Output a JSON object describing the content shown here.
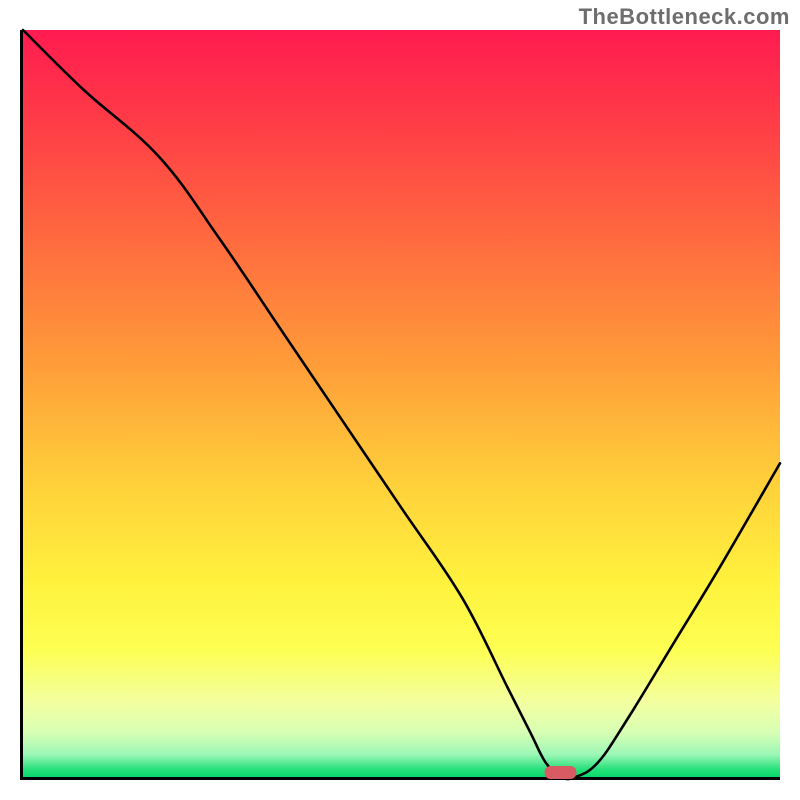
{
  "watermark": "TheBottleneck.com",
  "chart_data": {
    "type": "line",
    "title": "",
    "xlabel": "",
    "ylabel": "",
    "ylim": [
      0,
      100
    ],
    "xlim": [
      0,
      100
    ],
    "x": [
      0,
      8,
      18,
      26,
      34,
      42,
      50,
      58,
      64,
      67,
      69,
      71,
      73,
      76,
      80,
      86,
      92,
      100
    ],
    "values": [
      100,
      92,
      83,
      72,
      60,
      48,
      36,
      24,
      12,
      6,
      2,
      0,
      0,
      2,
      8,
      18,
      28,
      42
    ],
    "marker": {
      "x": 71,
      "y": 0
    },
    "gradient_stops": [
      {
        "pct": 0,
        "color": "#ff1b50"
      },
      {
        "pct": 28,
        "color": "#ff6a3f"
      },
      {
        "pct": 60,
        "color": "#ffce3a"
      },
      {
        "pct": 83,
        "color": "#fdff52"
      },
      {
        "pct": 97,
        "color": "#9cf7b6"
      },
      {
        "pct": 100,
        "color": "#08d86b"
      }
    ]
  }
}
